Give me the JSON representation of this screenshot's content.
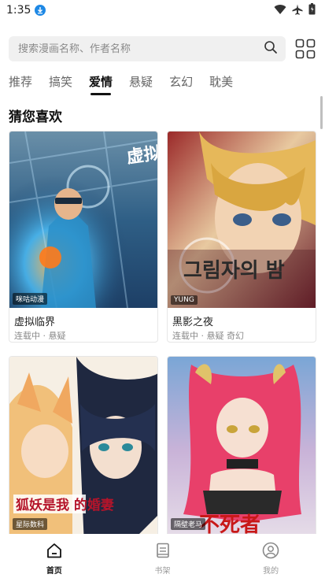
{
  "status": {
    "time": "1:35",
    "icons": [
      "download-icon",
      "wifi-icon",
      "airplane-icon",
      "battery-icon"
    ]
  },
  "search": {
    "placeholder": "搜索漫画名称、作者名称"
  },
  "tabs": [
    {
      "label": "推荐",
      "active": false
    },
    {
      "label": "搞笑",
      "active": false
    },
    {
      "label": "爱情",
      "active": true
    },
    {
      "label": "悬疑",
      "active": false
    },
    {
      "label": "玄幻",
      "active": false
    },
    {
      "label": "耽美",
      "active": false
    }
  ],
  "section": {
    "title": "猜您喜欢"
  },
  "cards": [
    {
      "title": "虚拟临界",
      "meta": "连载中 · 悬疑",
      "tag": "咪咕动漫",
      "cover_text": "虚拟临界"
    },
    {
      "title": "黑影之夜",
      "meta": "连载中 · 悬疑 奇幻",
      "tag": "YUNG",
      "cover_text": "그림자의 밤"
    },
    {
      "title": "",
      "meta": "",
      "tag": "星际数科",
      "cover_text": "狐妖是我 的婚妻"
    },
    {
      "title": "",
      "meta": "",
      "tag": "隔壁老马",
      "cover_text": "不死者"
    }
  ],
  "nav": [
    {
      "label": "首页",
      "icon": "home-icon",
      "active": true
    },
    {
      "label": "书架",
      "icon": "bookshelf-icon",
      "active": false
    },
    {
      "label": "我的",
      "icon": "profile-icon",
      "active": false
    }
  ],
  "colors": {
    "accent": "#111111",
    "inactive": "#999999",
    "search_bg": "#f0f0f0"
  }
}
